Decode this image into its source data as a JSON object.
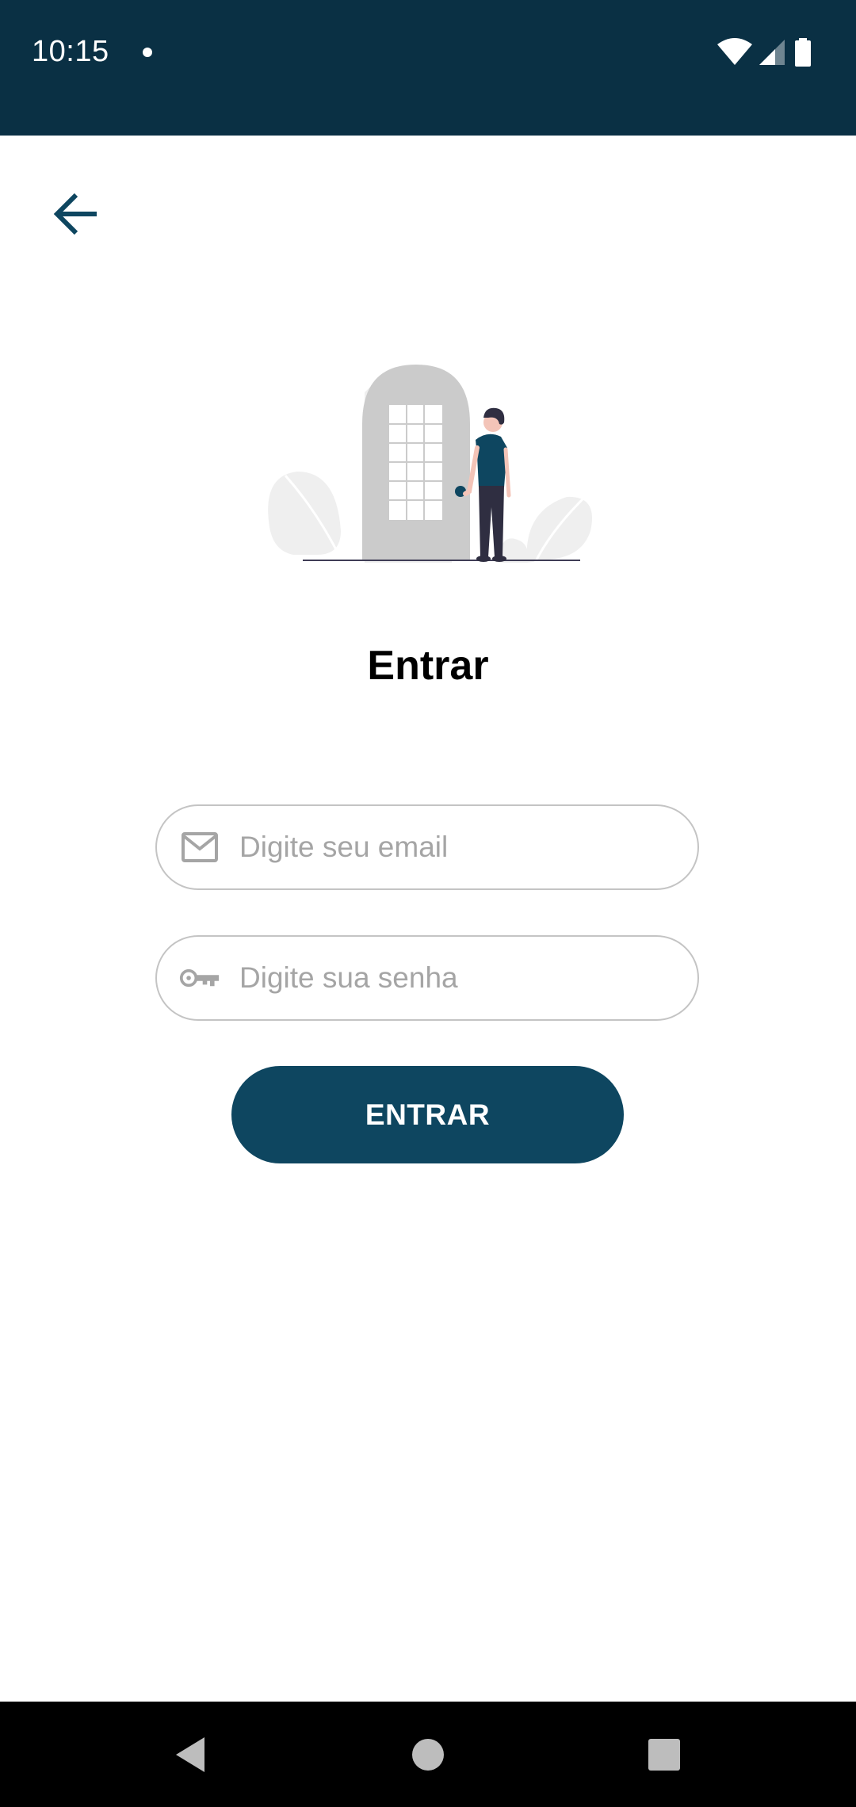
{
  "status_bar": {
    "time": "10:15",
    "background": "#0a3044"
  },
  "header": {
    "back_icon": "arrow-left-icon",
    "back_color": "#0e4660"
  },
  "login": {
    "title": "Entrar",
    "email": {
      "placeholder": "Digite seu email",
      "value": "",
      "icon": "mail-icon"
    },
    "password": {
      "placeholder": "Digite sua senha",
      "value": "",
      "icon": "key-icon"
    },
    "submit_label": "ENTRAR",
    "accent_color": "#0e4660"
  },
  "nav_bar": {
    "back_icon": "triangle-back-icon",
    "home_icon": "circle-home-icon",
    "recents_icon": "square-recents-icon"
  }
}
